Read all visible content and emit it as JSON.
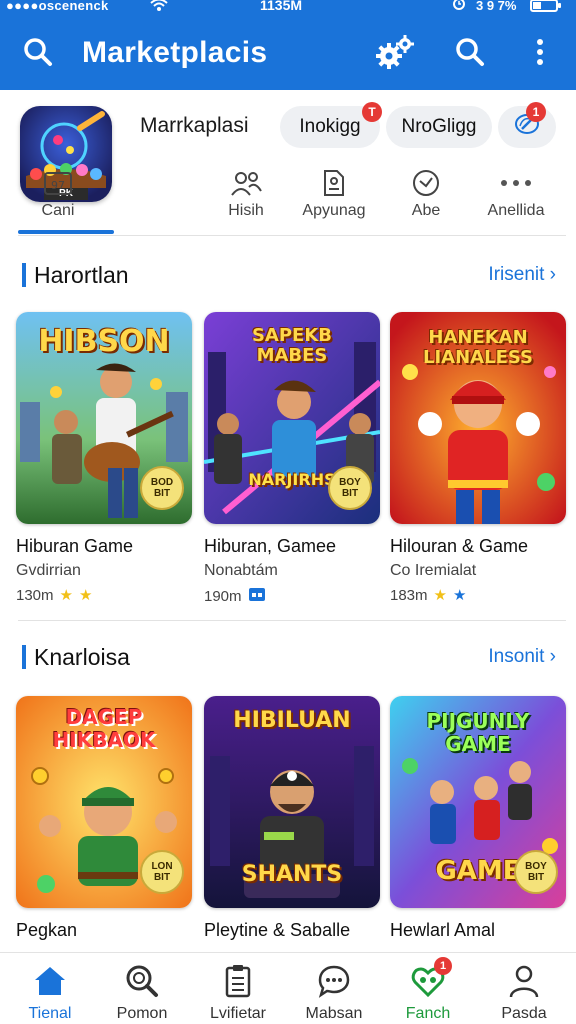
{
  "status_bar": {
    "carrier": "●●●●oscenenck",
    "time": "1135M",
    "battery_text": "3 9 7%"
  },
  "appbar": {
    "title": "Marketplacis"
  },
  "profile": {
    "app_name": "Marrkaplasi",
    "icon_caption": "PK",
    "pills": [
      {
        "label": "Inokigg",
        "badge": "T"
      },
      {
        "label": "NroGligg",
        "badge": ""
      },
      {
        "label": "",
        "badge": "1"
      }
    ]
  },
  "tabs": [
    {
      "label": "Cani",
      "icon": "calendar-icon",
      "badge": "97"
    },
    {
      "label": "Hisih",
      "icon": "people-icon"
    },
    {
      "label": "Apyunag",
      "icon": "document-icon"
    },
    {
      "label": "Abe",
      "icon": "clock-icon"
    },
    {
      "label": "Anellida",
      "icon": "more-icon"
    }
  ],
  "sections": [
    {
      "title": "Harortlan",
      "link": "Irisenit",
      "cards": [
        {
          "art_title": "HIBSON",
          "sticker": "BOD\nBIT",
          "title": "Hiburan Game",
          "subtitle": "Gvdirrian",
          "meta": "130m",
          "colors": [
            "#4aa3e8",
            "#2e7d32"
          ]
        },
        {
          "art_title": "SAPEKB\nMABES",
          "art_sub": "NARJIRHS",
          "sticker": "BOY\nBIT",
          "title": "Hiburan, Gamee",
          "subtitle": "Nonabtám",
          "meta": "190m",
          "colors": [
            "#6a2fb5",
            "#1a3a8c"
          ]
        },
        {
          "art_title": "HANEKAN\nLIANALESS",
          "title": "Hilouran & Game",
          "subtitle": "Co Iremialat",
          "meta": "183m",
          "colors": [
            "#ff7a1a",
            "#c62828"
          ]
        }
      ]
    },
    {
      "title": "Knarloisa",
      "link": "Insonit",
      "cards": [
        {
          "art_title": "DAGEP\nHIKBAOK",
          "sticker": "LON\nBIT",
          "title": "Pegkan",
          "colors": [
            "#ffcf2e",
            "#f06a1a"
          ]
        },
        {
          "art_title": "HIBILUAN",
          "art_sub": "SHANTS",
          "title": "Pleytine & Saballe",
          "colors": [
            "#4a1f8c",
            "#1a1a4a"
          ]
        },
        {
          "art_title": "PIJGUNLY\nGAME",
          "art_sub": "GAME",
          "sticker": "BOY\nBIT",
          "title": "Hewlarl Amal",
          "colors": [
            "#2ec4e8",
            "#7b2fbf"
          ]
        }
      ]
    }
  ],
  "bottom_nav": [
    {
      "label": "Tienal",
      "icon": "home-icon",
      "active": true
    },
    {
      "label": "Pomon",
      "icon": "search-icon"
    },
    {
      "label": "Lvifietar",
      "icon": "clipboard-icon"
    },
    {
      "label": "Mabsan",
      "icon": "chat-icon"
    },
    {
      "label": "Fanch",
      "icon": "heart-people-icon",
      "badge": "1"
    },
    {
      "label": "Pasda",
      "icon": "person-icon"
    }
  ],
  "theme": {
    "accent": "#1a73d9",
    "badge": "#e53935",
    "green": "#1e9a3c"
  }
}
